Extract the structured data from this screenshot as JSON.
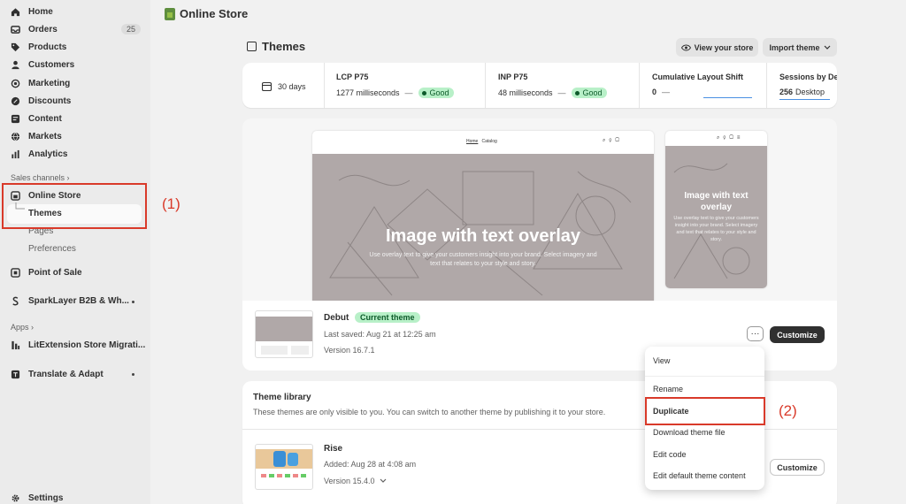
{
  "sidebar": {
    "items": [
      {
        "label": "Home",
        "icon": "home-icon"
      },
      {
        "label": "Orders",
        "icon": "inbox-icon",
        "badge": "25"
      },
      {
        "label": "Products",
        "icon": "tag-icon"
      },
      {
        "label": "Customers",
        "icon": "person-icon"
      },
      {
        "label": "Marketing",
        "icon": "target-icon"
      },
      {
        "label": "Discounts",
        "icon": "discount-icon"
      },
      {
        "label": "Content",
        "icon": "content-icon"
      },
      {
        "label": "Markets",
        "icon": "globe-icon"
      },
      {
        "label": "Analytics",
        "icon": "bar-chart-icon"
      }
    ],
    "sales_channels_label": "Sales channels",
    "online_store": "Online Store",
    "online_store_sub": [
      "Themes",
      "Pages",
      "Preferences"
    ],
    "point_of_sale": "Point of Sale",
    "sparklayer": "SparkLayer B2B & Wh...",
    "apps_label": "Apps",
    "litextension": "LitExtension Store Migrati...",
    "translate": "Translate & Adapt",
    "settings": "Settings"
  },
  "annotations": {
    "one": "(1)",
    "two": "(2)"
  },
  "header": {
    "store_title": "Online Store"
  },
  "themes_page": {
    "title": "Themes",
    "view_store": "View your store",
    "import_theme": "Import theme"
  },
  "metrics": {
    "period": "30 days",
    "lcp_title": "LCP P75",
    "lcp_value": "1277 milliseconds",
    "lcp_status": "Good",
    "inp_title": "INP P75",
    "inp_value": "48 milliseconds",
    "inp_status": "Good",
    "cls_title": "Cumulative Layout Shift",
    "cls_value": "0",
    "sessions_title": "Sessions by De",
    "sessions_value": "256",
    "sessions_device": "Desktop",
    "dash": "—"
  },
  "preview": {
    "nav_home": "Home",
    "nav_catalog": "Catalog",
    "hero_title": "Image with text overlay",
    "hero_sub": "Use overlay text to give your customers insight into your brand. Select imagery and text that relates to your style and story.",
    "mobile_title": "Image with text overlay",
    "mobile_sub": "Use overlay text to give your customers insight into your brand. Select imagery and text that relates to your style and story."
  },
  "current_theme": {
    "name": "Debut",
    "badge": "Current theme",
    "saved": "Last saved: Aug 21 at 12:25 am",
    "version": "Version 16.7.1",
    "customize": "Customize",
    "more": "···"
  },
  "library": {
    "title": "Theme library",
    "description": "These themes are only visible to you. You can switch to another theme by publishing it to your store.",
    "theme_name": "Rise",
    "added": "Added: Aug 28 at 4:08 am",
    "version": "Version 15.4.0",
    "customize": "Customize"
  },
  "menu": {
    "items": [
      "View",
      "Rename",
      "Duplicate",
      "Download theme file",
      "Edit code",
      "Edit default theme content"
    ]
  }
}
